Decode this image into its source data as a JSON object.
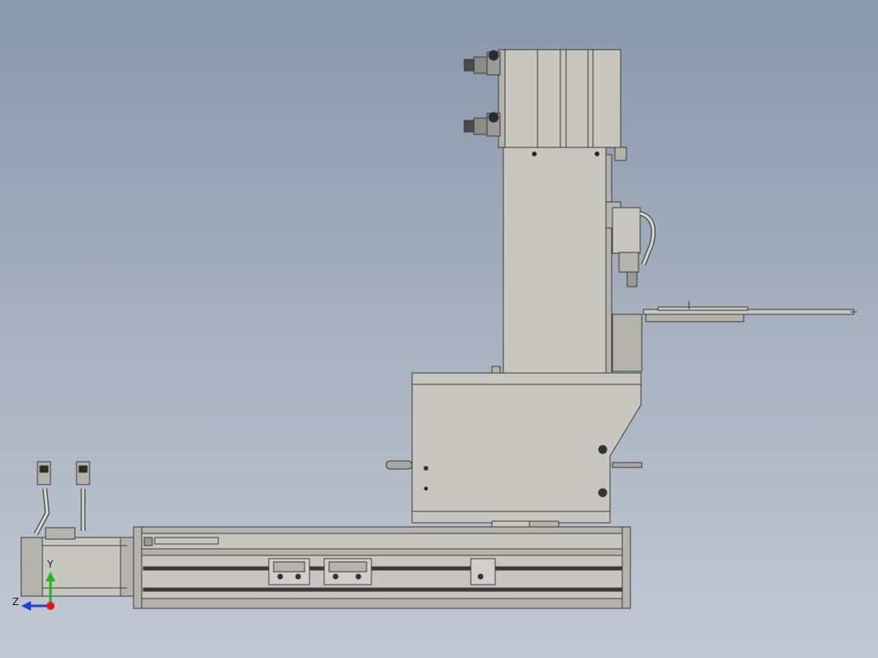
{
  "axes": {
    "y_label": "Y",
    "z_label": "Z",
    "y_color": "#1fb81f",
    "z_color": "#1e3fd8",
    "origin_color": "#e4161b"
  },
  "colors": {
    "body": "#c7c7c0",
    "body_shade": "#b4b4ad",
    "edge": "#3a3a3a",
    "dark": "#4a4a4a",
    "background_top": "#8a98ac",
    "background_bottom": "#c3c8d4"
  }
}
